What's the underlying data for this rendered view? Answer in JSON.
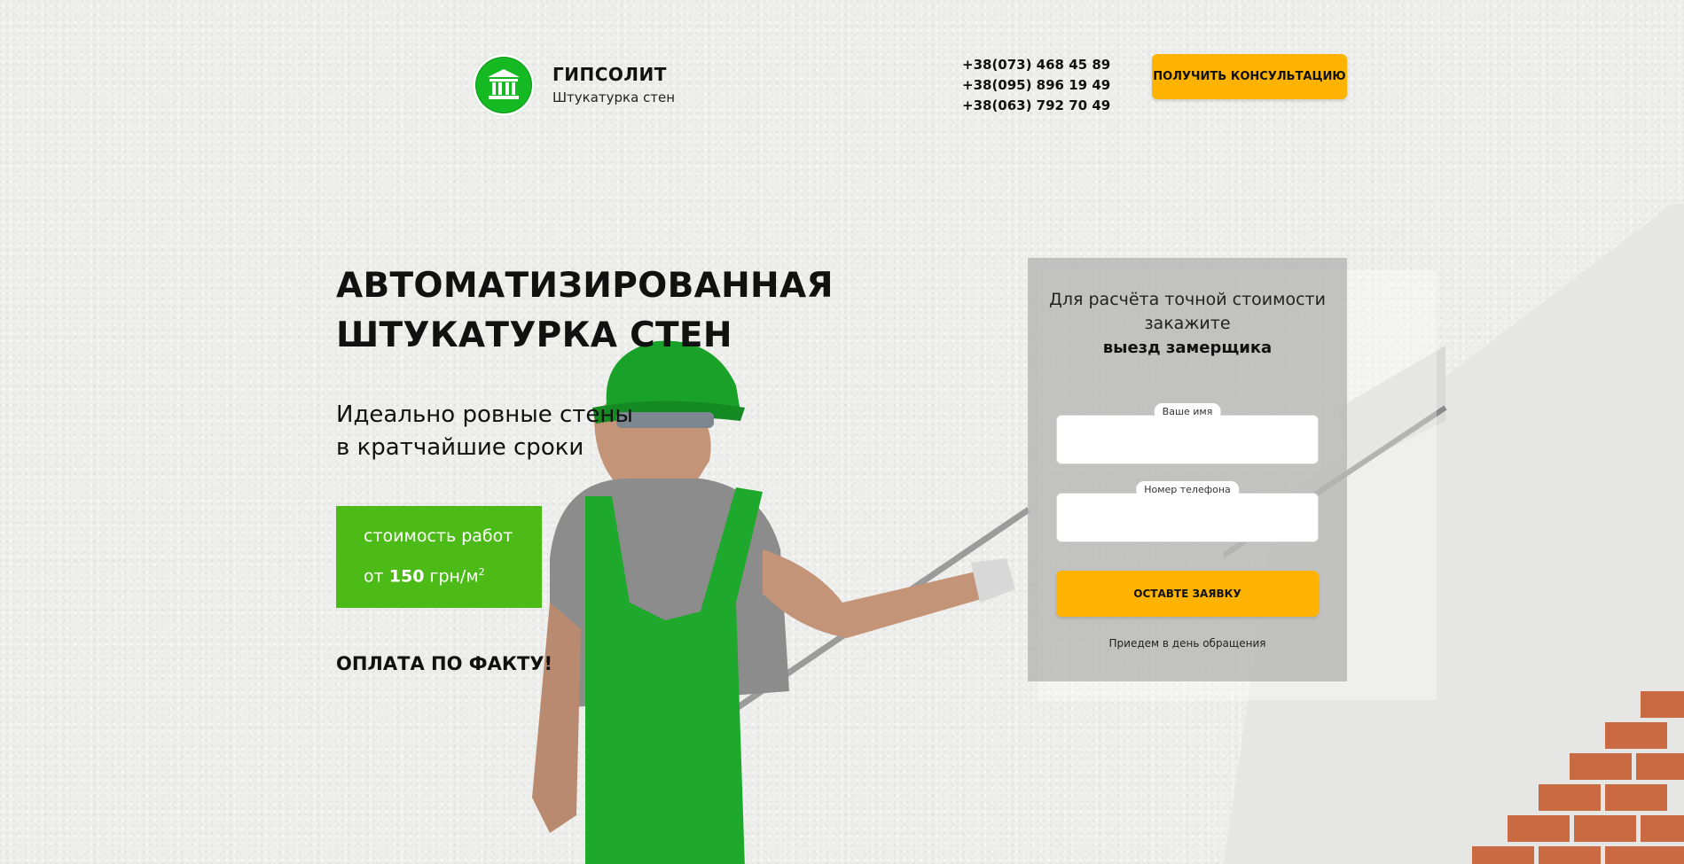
{
  "header": {
    "brand_name": "ГИПСОЛИТ",
    "brand_subtitle": "Штукатурка стен",
    "phones": [
      "+38(073) 468 45 89",
      "+38(095) 896 19 49",
      "+38(063) 792 70 49"
    ],
    "consult_button": "ПОЛУЧИТЬ КОНСУЛЬТАЦИЮ",
    "logo_icon": "building-columns-icon"
  },
  "hero": {
    "title_line1": "АВТОМАТИЗИРОВАННАЯ",
    "title_line2": "ШТУКАТУРКА СТЕН",
    "subtitle_line1": "Идеально ровные стены",
    "subtitle_line2": "в кратчайшие сроки",
    "price_line1": "стоимость работ",
    "price_prefix": "от",
    "price_value": "150",
    "price_unit": "грн/м",
    "price_unit_sup": "2",
    "payment_note": "ОПЛАТА ПО ФАКТУ!"
  },
  "form": {
    "intro_line1": "Для расчёта точной стоимости",
    "intro_line2": "закажите",
    "intro_strong": "выезд замерщика",
    "name_label": "Ваше имя",
    "name_value": "",
    "phone_label": "Номер телефона",
    "phone_value": "",
    "submit_label": "ОСТАВТЕ ЗАЯВКУ",
    "note": "Приедем в день обращения"
  },
  "colors": {
    "accent_green": "#4cbb17",
    "logo_green": "#15b922",
    "button_yellow": "#fdb300",
    "form_bg": "#b4b4b4"
  }
}
